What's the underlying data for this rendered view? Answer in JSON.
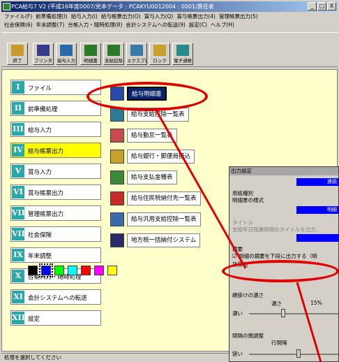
{
  "window": {
    "title": "PCA給与7 V2 (平成16年度0007/見本データ : PCAKYU0012004 : 0001/責任者",
    "buttons": [
      "_",
      "□",
      "X"
    ]
  },
  "menubar": {
    "row1": [
      "ファイル(F)",
      "前準備処理(I)",
      "給与入力(I)",
      "給与帳票出力(O)",
      "賞与入力(Q)",
      "賞与帳票出力(4)",
      "管理帳票出力(5)"
    ],
    "row2": [
      "社会保険(6)",
      "年末調整(7)",
      "台帳入力・随時処理(8)",
      "会計システムへの転送(9)",
      "設定(C)",
      "ヘルプ(H)"
    ]
  },
  "toolbar": {
    "items": [
      {
        "label": "終了",
        "icon": "exit-icon"
      },
      {
        "label": "プリンタ",
        "icon": "printer-icon"
      },
      {
        "label": "給与入力",
        "icon": "salary-input-icon"
      },
      {
        "label": "明細書",
        "icon": "statement-icon"
      },
      {
        "label": "支給控除",
        "icon": "deduction-icon"
      },
      {
        "label": "エクスプローラ",
        "icon": "explorer-icon"
      },
      {
        "label": "ロック",
        "icon": "lock-icon"
      },
      {
        "label": "電子通帳",
        "icon": "passbook-icon"
      }
    ]
  },
  "left_menu": {
    "items": [
      {
        "num": "I",
        "label": "ファイル"
      },
      {
        "num": "II",
        "label": "前準備処理"
      },
      {
        "num": "III",
        "label": "給与入力"
      },
      {
        "num": "IV",
        "label": "給与帳票出力"
      },
      {
        "num": "V",
        "label": "賞与入力"
      },
      {
        "num": "VI",
        "label": "賞与帳票出力"
      },
      {
        "num": "VII",
        "label": "管理帳票出力"
      },
      {
        "num": "VIII",
        "label": "社会保険"
      },
      {
        "num": "IX",
        "label": "年末調整"
      },
      {
        "num": "X",
        "label": "台帳入力・随時処理"
      },
      {
        "num": "XI",
        "label": "会計システムへの転送"
      },
      {
        "num": "XII",
        "label": "設定"
      }
    ],
    "selected_index": 3
  },
  "sub_menu": {
    "items": [
      {
        "label": "給与明細書",
        "icon": "statement-icon"
      },
      {
        "label": "給与支給控除一覧表",
        "icon": "list-icon"
      },
      {
        "label": "給与勤怠一覧表",
        "icon": "attendance-icon"
      },
      {
        "label": "給与銀行・郵便局振込",
        "icon": "bank-icon"
      },
      {
        "label": "給与支払金種表",
        "icon": "cash-icon"
      },
      {
        "label": "給与住民税納付先一覧表",
        "icon": "tax-icon"
      },
      {
        "label": "給与汎用支給控除一覧表",
        "icon": "general-list-icon"
      },
      {
        "label": "地方税一括納付システム",
        "icon": "local-tax-icon"
      }
    ],
    "selected_index": 0
  },
  "status": "処理を選択してください",
  "dialog": {
    "title": "出力設定",
    "top_value": "連続",
    "paper_group": "用紙種別",
    "paper_value": "明細書の様式",
    "style_value": "明細",
    "title_group": "タイトル",
    "title_hint": "支給年日残業時間のタイトルを出力",
    "summary_group": "摘要",
    "summary_check": "☑ 明細の摘要を下段に出力する（明",
    "colors_label": "背景色",
    "colors": [
      "#000000",
      "#0000ff",
      "#00ff00",
      "#00ffff",
      "#ff0000",
      "#ff00ff",
      "#ffff00"
    ],
    "selected_color_index": 1,
    "shade_label": "網掛けの濃さ",
    "shade_dark": "濃い",
    "shade_mid": "濃さ",
    "shade_pct": "15%",
    "spacing_label": "間隔の微調整",
    "spacing_mid": "行間隔",
    "spacing_narrow": "狭い"
  }
}
